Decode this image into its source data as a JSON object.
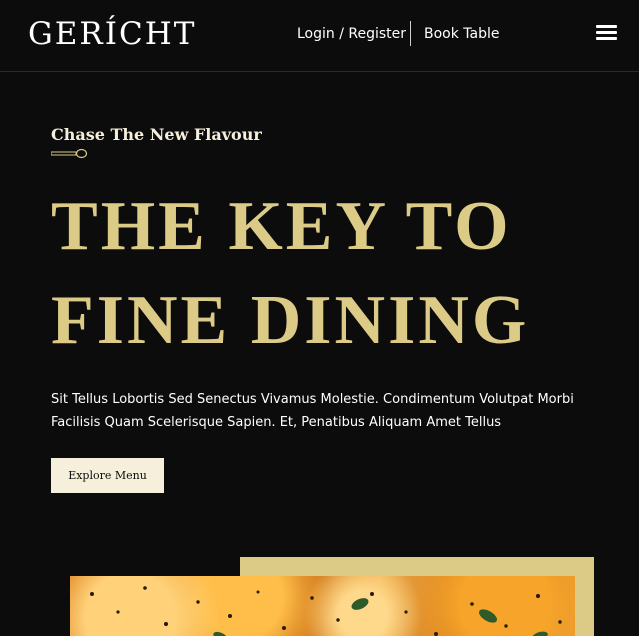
{
  "header": {
    "logo": "GERÍCHT",
    "login_label": "Login / Register",
    "book_label": "Book Table",
    "menu_icon": "hamburger-menu-icon"
  },
  "hero": {
    "subtitle": "Chase The New Flavour",
    "divider_icon": "spoon-icon",
    "title_line1": "THE KEY TO",
    "title_line2": "FINE DINING",
    "description": "Sit Tellus Lobortis Sed Senectus Vivamus Molestie. Condimentum Volutpat Morbi Facilisis Quam Scelerisque Sapien. Et, Penatibus Aliquam Amet Tellus",
    "cta_label": "Explore Menu"
  },
  "colors": {
    "background": "#0c0c0c",
    "golden": "#dcca87",
    "crimson": "#f5efdb",
    "white": "#ffffff"
  }
}
